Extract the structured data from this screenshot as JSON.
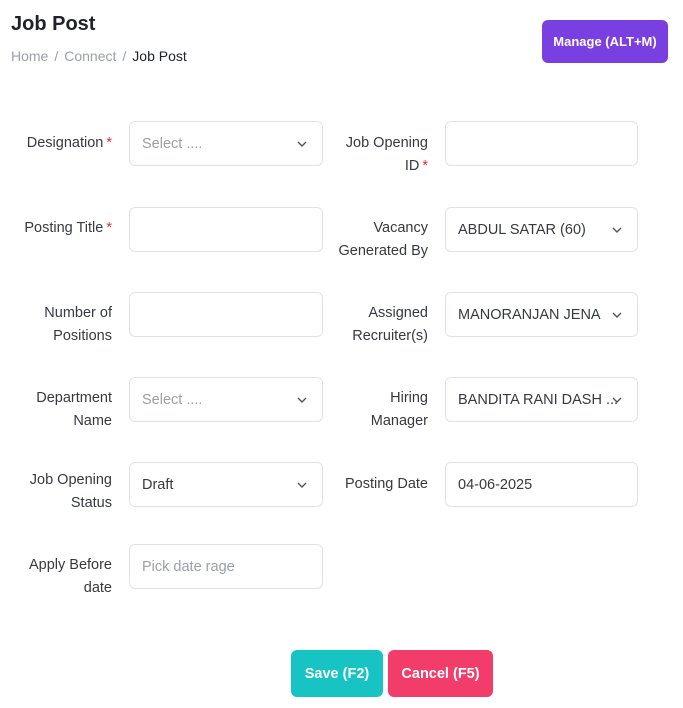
{
  "page": {
    "title": "Job Post"
  },
  "breadcrumb": {
    "home": "Home",
    "connect": "Connect",
    "current": "Job Post",
    "separator": "/"
  },
  "manage_button": "Manage (ALT+M)",
  "form": {
    "designation": {
      "label": "Designation",
      "required": "*",
      "placeholder": "Select ...."
    },
    "job_opening_id": {
      "label_line1": "Job Opening",
      "label_line2": "ID",
      "required": "*",
      "value": ""
    },
    "posting_title": {
      "label": "Posting Title",
      "required": "*",
      "value": ""
    },
    "vacancy_generated_by": {
      "label_line1": "Vacancy",
      "label_line2": "Generated By",
      "value": "ABDUL SATAR (60)"
    },
    "number_of_positions": {
      "label_line1": "Number of",
      "label_line2": "Positions",
      "value": ""
    },
    "assigned_recruiters": {
      "label_line1": "Assigned",
      "label_line2": "Recruiter(s)",
      "value": "MANORANJAN JENA"
    },
    "department_name": {
      "label_line1": "Department",
      "label_line2": "Name",
      "placeholder": "Select ...."
    },
    "hiring_manager": {
      "label_line1": "Hiring",
      "label_line2": "Manager",
      "value": "BANDITA RANI DASH ..."
    },
    "job_opening_status": {
      "label_line1": "Job Opening",
      "label_line2": "Status",
      "value": "Draft"
    },
    "posting_date": {
      "label": "Posting Date",
      "value": "04-06-2025"
    },
    "apply_before_date": {
      "label_line1": "Apply Before",
      "label_line2": "date",
      "placeholder": "Pick date rage"
    }
  },
  "actions": {
    "save": "Save (F2)",
    "cancel": "Cancel (F5)"
  },
  "colors": {
    "primary": "#7a3fe0",
    "save": "#18c3c3",
    "cancel": "#f23d6b",
    "required": "#e0303a"
  }
}
